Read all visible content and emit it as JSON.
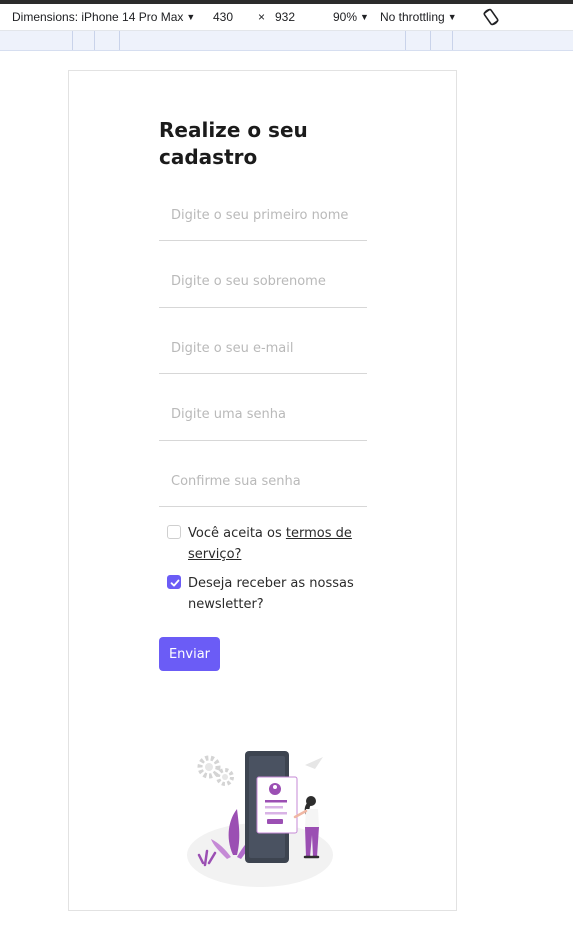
{
  "devtools": {
    "dimensions_label": "Dimensions: iPhone 14 Pro Max",
    "width_value": "430",
    "times_sign": "×",
    "height_value": "932",
    "zoom": "90%",
    "throttling": "No throttling",
    "caret": "▼"
  },
  "form": {
    "title": "Realize o seu cadastro",
    "fields": [
      {
        "placeholder": "Digite o seu primeiro nome"
      },
      {
        "placeholder": "Digite o seu sobrenome"
      },
      {
        "placeholder": "Digite o seu e-mail"
      },
      {
        "placeholder": "Digite uma senha"
      },
      {
        "placeholder": "Confirme sua senha"
      }
    ],
    "terms": {
      "text_before": "Você aceita os ",
      "link": "termos de serviço?",
      "checked": false
    },
    "newsletter": {
      "text": "Deseja receber as nossas newsletter?",
      "checked": true
    },
    "submit_label": "Enviar"
  },
  "colors": {
    "accent": "#6b5cf6",
    "illustration_purple": "#9b4fb3",
    "illustration_dark": "#3d4450"
  }
}
